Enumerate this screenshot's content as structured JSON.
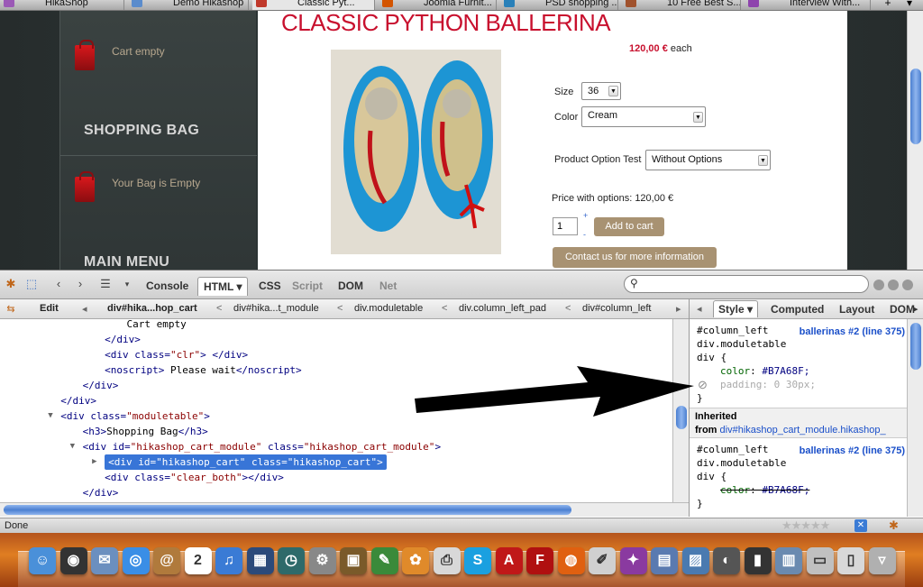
{
  "browser": {
    "tabs": [
      {
        "label": "HikaShop",
        "icon_color": "#9b59b6",
        "active": false
      },
      {
        "label": "Demo Hikashop",
        "icon_color": "#5b8ccc",
        "active": false
      },
      {
        "label": "Classic Pyt...",
        "icon_color": "#c0392b",
        "active": true
      },
      {
        "label": "Joomla Furnit...",
        "icon_color": "#d35400",
        "active": false
      },
      {
        "label": "PSD shopping ...",
        "icon_color": "#2980b9",
        "active": false
      },
      {
        "label": "10 Free Best S...",
        "icon_color": "#a0522d",
        "active": false
      },
      {
        "label": "Interview With...",
        "icon_color": "#8e44ad",
        "active": false
      }
    ],
    "new_tab": "+",
    "tab_list": "▾"
  },
  "sidebar": {
    "cart_empty": "Cart empty",
    "shopping_bag_heading": "SHOPPING BAG",
    "bag_empty": "Your Bag is Empty",
    "main_menu_heading": "MAIN MENU"
  },
  "product": {
    "title": "CLASSIC PYTHON BALLERINA",
    "price_amount": "120,00 €",
    "price_unit": "each",
    "size_label": "Size",
    "size_value": "36",
    "color_label": "Color",
    "color_value": "Cream",
    "option_label": "Product Option Test",
    "option_value": "Without Options",
    "price_with_options": "Price with options: 120,00 €",
    "quantity": "1",
    "add_to_cart": "Add to cart",
    "contact": "Contact us for more information",
    "colors": {
      "title": "#c8102e",
      "button": "#a89272"
    }
  },
  "firebug": {
    "tabs": [
      "Console",
      "HTML",
      "CSS",
      "Script",
      "DOM",
      "Net"
    ],
    "html_tab_arrow": "▾",
    "search_placeholder": "",
    "edit_label": "Edit",
    "breadcrumbs": [
      "div#hika...hop_cart",
      "div#hika...t_module",
      "div.moduletable",
      "div.column_left_pad",
      "div#column_left"
    ],
    "html_lines": [
      {
        "indent": 6,
        "text": "Cart empty"
      },
      {
        "indent": 5,
        "parts": [
          [
            "tg",
            "</div>"
          ]
        ]
      },
      {
        "indent": 5,
        "parts": [
          [
            "tg",
            "<div "
          ],
          [
            "an",
            "class="
          ],
          [
            "av",
            "\"clr\""
          ],
          [
            "tg",
            "> </div>"
          ]
        ]
      },
      {
        "indent": 5,
        "parts": [
          [
            "tg",
            "<noscript>"
          ],
          [
            "tx",
            " Please wait"
          ],
          [
            "tg",
            "</noscript>"
          ]
        ]
      },
      {
        "indent": 4,
        "parts": [
          [
            "tg",
            "</div>"
          ]
        ]
      },
      {
        "indent": 3,
        "parts": [
          [
            "tg",
            "</div>"
          ]
        ]
      },
      {
        "indent": 3,
        "parts": [
          [
            "tg",
            "<div "
          ],
          [
            "an",
            "class="
          ],
          [
            "av",
            "\"moduletable\""
          ],
          [
            "tg",
            ">"
          ]
        ]
      },
      {
        "indent": 4,
        "parts": [
          [
            "tg",
            "<h3>"
          ],
          [
            "tx",
            "Shopping Bag"
          ],
          [
            "tg",
            "</h3>"
          ]
        ]
      },
      {
        "indent": 4,
        "parts": [
          [
            "tg",
            "<div "
          ],
          [
            "an",
            "id="
          ],
          [
            "av",
            "\"hikashop_cart_module\""
          ],
          [
            "an",
            " class="
          ],
          [
            "av",
            "\"hikashop_cart_module\""
          ],
          [
            "tg",
            ">"
          ]
        ]
      },
      {
        "indent": 5,
        "selected": true,
        "parts": [
          [
            "tg",
            "<div "
          ],
          [
            "an",
            "id="
          ],
          [
            "av",
            "\"hikashop_cart\""
          ],
          [
            "an",
            " class="
          ],
          [
            "av",
            "\"hikashop_cart\""
          ],
          [
            "tg",
            ">"
          ]
        ]
      },
      {
        "indent": 5,
        "parts": [
          [
            "tg",
            "<div "
          ],
          [
            "an",
            "class="
          ],
          [
            "av",
            "\"clear_both\""
          ],
          [
            "tg",
            "></div>"
          ]
        ]
      },
      {
        "indent": 4,
        "parts": [
          [
            "tg",
            "</div>"
          ]
        ]
      }
    ],
    "side_tabs": [
      "Style",
      "Computed",
      "Layout",
      "DOM"
    ],
    "style_arrow": "▾",
    "rules": {
      "rule1_selector": [
        "#column_left",
        "div.moduletable",
        "div {"
      ],
      "rule1_source": "ballerinas #2 (line 375)",
      "rule1_prop1": "color",
      "rule1_val1": "#B7A68F;",
      "rule1_prop2": "padding",
      "rule1_val2": "0 30px;",
      "close": "}",
      "inherited_label": "Inherited",
      "inherited_from": "from",
      "inherited_link": "div#hikashop_cart_module.hikashop_",
      "rule2_selector": [
        "#column_left",
        "div.moduletable",
        "div {"
      ],
      "rule2_source": "ballerinas #2 (line 375)",
      "rule2_prop1": "color",
      "rule2_val1": "#B7A68F;"
    }
  },
  "status": {
    "text": "Done",
    "stars": "★★★★★"
  },
  "dock": {
    "items": [
      {
        "name": "finder-icon",
        "color": "#4a90d9",
        "glyph": "☺"
      },
      {
        "name": "dashboard-icon",
        "color": "#333",
        "glyph": "◉"
      },
      {
        "name": "mail-icon",
        "color": "#6b8fbf",
        "glyph": "✉"
      },
      {
        "name": "safari-icon",
        "color": "#3a8ee6",
        "glyph": "◎"
      },
      {
        "name": "address-book-icon",
        "color": "#b07a3c",
        "glyph": "@"
      },
      {
        "name": "ical-icon",
        "color": "#ffffff",
        "glyph": "2"
      },
      {
        "name": "itunes-icon",
        "color": "#3a7bd5",
        "glyph": "♫"
      },
      {
        "name": "spaces-icon",
        "color": "#2c4a7a",
        "glyph": "▦"
      },
      {
        "name": "time-machine-icon",
        "color": "#2e6a6a",
        "glyph": "◷"
      },
      {
        "name": "system-preferences-icon",
        "color": "#888",
        "glyph": "⚙"
      },
      {
        "name": "photo-icon",
        "color": "#7a5a2a",
        "glyph": "▣"
      },
      {
        "name": "feather-icon",
        "color": "#3a8a3a",
        "glyph": "✎"
      },
      {
        "name": "flower-icon",
        "color": "#e08a2a",
        "glyph": "✿"
      },
      {
        "name": "pdf-icon",
        "color": "#d8d8d8",
        "glyph": "⎙"
      },
      {
        "name": "skype-icon",
        "color": "#1aa0e0",
        "glyph": "S"
      },
      {
        "name": "acrobat-icon",
        "color": "#c01818",
        "glyph": "A"
      },
      {
        "name": "filezilla-icon",
        "color": "#b01010",
        "glyph": "F"
      },
      {
        "name": "firefox-icon",
        "color": "#e06010",
        "glyph": "◍"
      },
      {
        "name": "script-editor-icon",
        "color": "#d0d0d0",
        "glyph": "✐"
      },
      {
        "name": "dictionary-icon",
        "color": "#8a3aa0",
        "glyph": "✦"
      },
      {
        "name": "folder-icon",
        "color": "#5a7ab0",
        "glyph": "▤"
      },
      {
        "name": "preview-icon",
        "color": "#4a7ab0",
        "glyph": "▨"
      },
      {
        "name": "iphoto-icon",
        "color": "#555",
        "glyph": "◐"
      },
      {
        "name": "console-icon",
        "color": "#333",
        "glyph": "▮"
      },
      {
        "name": "downloads-icon",
        "color": "#6a8ab0",
        "glyph": "▥"
      },
      {
        "name": "documents-icon",
        "color": "#c0c0c0",
        "glyph": "▭"
      },
      {
        "name": "stack-icon",
        "color": "#d8d8d8",
        "glyph": "▯"
      },
      {
        "name": "trash-icon",
        "color": "#b0b0b0",
        "glyph": "▿"
      }
    ]
  }
}
